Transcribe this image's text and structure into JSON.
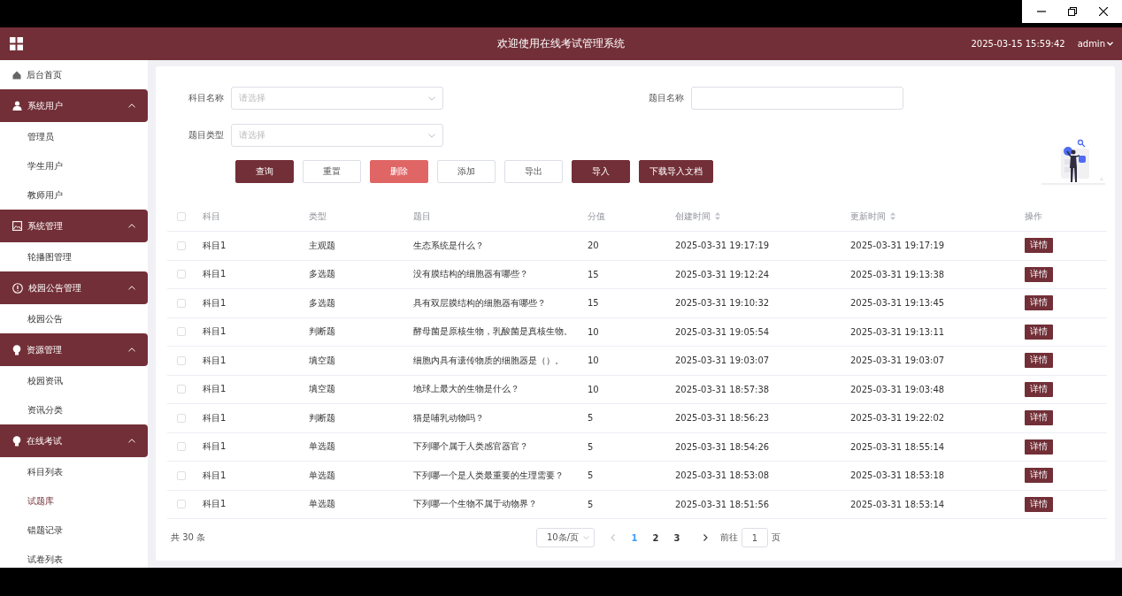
{
  "header": {
    "title": "欢迎使用在线考试管理系统",
    "datetime": "2025-03-15 15:59:42",
    "user": "admin"
  },
  "sidebar": {
    "home": {
      "label": "后台首页"
    },
    "groups": [
      {
        "label": "系统用户",
        "expanded": true,
        "children": [
          {
            "label": "管理员",
            "selected": false
          },
          {
            "label": "学生用户",
            "selected": false
          },
          {
            "label": "教师用户",
            "selected": false
          }
        ]
      },
      {
        "label": "系统管理",
        "expanded": true,
        "children": [
          {
            "label": "轮播图管理",
            "selected": false
          }
        ]
      },
      {
        "label": "校园公告管理",
        "expanded": true,
        "children": [
          {
            "label": "校园公告",
            "selected": false
          }
        ]
      },
      {
        "label": "资源管理",
        "expanded": true,
        "children": [
          {
            "label": "校园资讯",
            "selected": false
          },
          {
            "label": "资讯分类",
            "selected": false
          }
        ]
      },
      {
        "label": "在线考试",
        "expanded": true,
        "children": [
          {
            "label": "科目列表",
            "selected": false
          },
          {
            "label": "试题库",
            "selected": true
          },
          {
            "label": "错题记录",
            "selected": false
          },
          {
            "label": "试卷列表",
            "selected": false
          }
        ]
      }
    ]
  },
  "filters": [
    {
      "label": "科目名称",
      "kind": "select",
      "placeholder": "请选择"
    },
    {
      "label": "题目名称",
      "kind": "input"
    },
    {
      "label": "题目类型",
      "kind": "select",
      "placeholder": "请选择"
    }
  ],
  "buttons": [
    {
      "label": "查询",
      "kind": "primary"
    },
    {
      "label": "重置",
      "kind": "default"
    },
    {
      "label": "删除",
      "kind": "danger"
    },
    {
      "label": "添加",
      "kind": "default"
    },
    {
      "label": "导出",
      "kind": "default"
    },
    {
      "label": "导入",
      "kind": "primary"
    },
    {
      "label": "下载导入文档",
      "kind": "primary"
    }
  ],
  "table": {
    "all_checked": false,
    "columns": [
      {
        "label": "科目",
        "sortable": false
      },
      {
        "label": "类型",
        "sortable": false
      },
      {
        "label": "题目",
        "sortable": false
      },
      {
        "label": "分值",
        "sortable": false
      },
      {
        "label": "创建时间",
        "sortable": true
      },
      {
        "label": "更新时间",
        "sortable": true
      },
      {
        "label": "操作",
        "sortable": false
      }
    ],
    "rows": [
      {
        "checked": false,
        "cells": [
          "科目1",
          "主观题",
          "生态系统是什么？",
          "20",
          "2025-03-31 19:17:19",
          "2025-03-31 19:17:19"
        ],
        "action": "详情"
      },
      {
        "checked": false,
        "cells": [
          "科目1",
          "多选题",
          "没有膜结构的细胞器有哪些？",
          "15",
          "2025-03-31 19:12:24",
          "2025-03-31 19:13:38"
        ],
        "action": "详情"
      },
      {
        "checked": false,
        "cells": [
          "科目1",
          "多选题",
          "具有双层膜结构的细胞器有哪些？",
          "15",
          "2025-03-31 19:10:32",
          "2025-03-31 19:13:45"
        ],
        "action": "详情"
      },
      {
        "checked": false,
        "cells": [
          "科目1",
          "判断题",
          "酵母菌是原核生物，乳酸菌是真核生物。",
          "10",
          "2025-03-31 19:05:54",
          "2025-03-31 19:13:11"
        ],
        "action": "详情"
      },
      {
        "checked": false,
        "cells": [
          "科目1",
          "填空题",
          "细胞内具有遗传物质的细胞器是（）。",
          "10",
          "2025-03-31 19:03:07",
          "2025-03-31 19:03:07"
        ],
        "action": "详情"
      },
      {
        "checked": false,
        "cells": [
          "科目1",
          "填空题",
          "地球上最大的生物是什么？",
          "10",
          "2025-03-31 18:57:38",
          "2025-03-31 19:03:48"
        ],
        "action": "详情"
      },
      {
        "checked": false,
        "cells": [
          "科目1",
          "判断题",
          "猫是哺乳动物吗？",
          "5",
          "2025-03-31 18:56:23",
          "2025-03-31 19:22:02"
        ],
        "action": "详情"
      },
      {
        "checked": false,
        "cells": [
          "科目1",
          "单选题",
          "下列哪个属于人类感官器官？",
          "5",
          "2025-03-31 18:54:26",
          "2025-03-31 18:55:14"
        ],
        "action": "详情"
      },
      {
        "checked": false,
        "cells": [
          "科目1",
          "单选题",
          "下列哪一个是人类最重要的生理需要？",
          "5",
          "2025-03-31 18:53:08",
          "2025-03-31 18:53:18"
        ],
        "action": "详情"
      },
      {
        "checked": false,
        "cells": [
          "科目1",
          "单选题",
          "下列哪一个生物不属于动物界？",
          "5",
          "2025-03-31 18:51:56",
          "2025-03-31 18:53:14"
        ],
        "action": "详情"
      }
    ]
  },
  "pagination": {
    "total": "共 30 条",
    "page_size": "10条/页",
    "pages": [
      {
        "label": "1",
        "selected": true
      },
      {
        "label": "2",
        "selected": false
      },
      {
        "label": "3",
        "selected": false
      }
    ],
    "goto_label": "前往",
    "goto_value": "1",
    "goto_suffix": "页"
  }
}
